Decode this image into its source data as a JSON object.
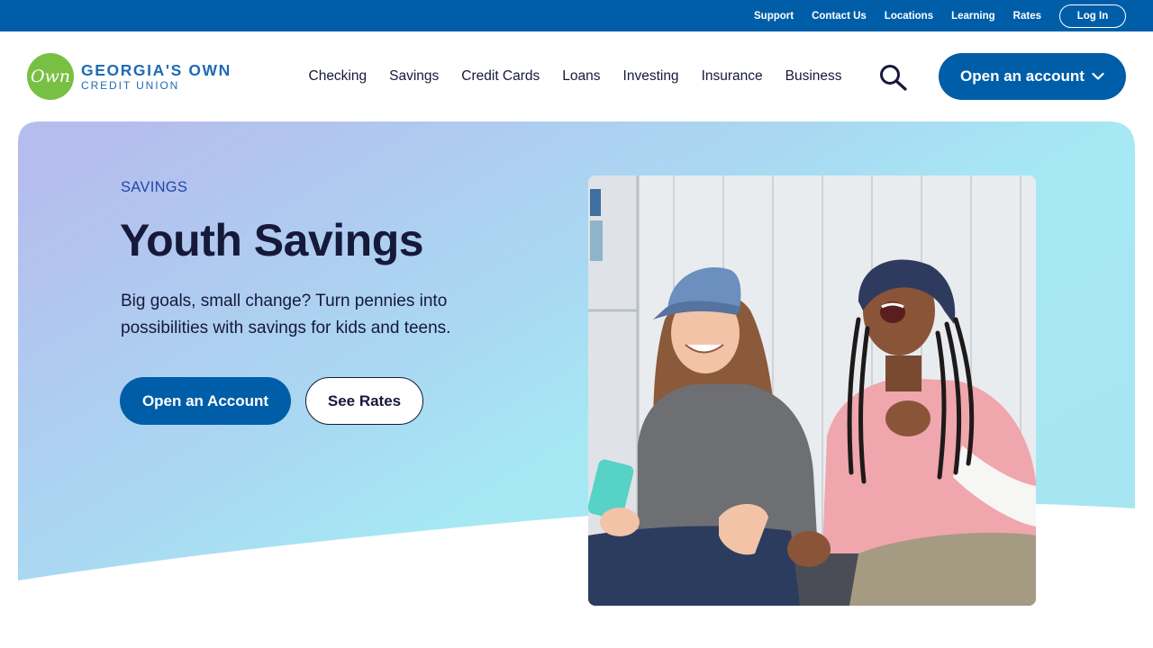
{
  "utility_nav": {
    "links": [
      "Support",
      "Contact Us",
      "Locations",
      "Learning",
      "Rates"
    ],
    "login_label": "Log In"
  },
  "logo": {
    "mark_text": "Own",
    "line1": "GEORGIA'S OWN",
    "line2": "CREDIT UNION"
  },
  "primary_nav": {
    "items": [
      "Checking",
      "Savings",
      "Credit Cards",
      "Loans",
      "Investing",
      "Insurance",
      "Business"
    ],
    "search_icon": "search-icon",
    "open_account_label": "Open an account"
  },
  "hero": {
    "eyebrow": "SAVINGS",
    "title": "Youth Savings",
    "description": "Big goals, small change? Turn pennies into possibilities with savings for kids and teens.",
    "primary_cta": "Open an Account",
    "secondary_cta": "See Rates"
  },
  "colors": {
    "brand_blue": "#005ea8",
    "logo_green": "#78c043",
    "text_dark": "#16193a",
    "eyebrow_blue": "#2346a8",
    "hero_gradient_start": "#b5bdee",
    "hero_gradient_end": "#a6e8f4"
  }
}
